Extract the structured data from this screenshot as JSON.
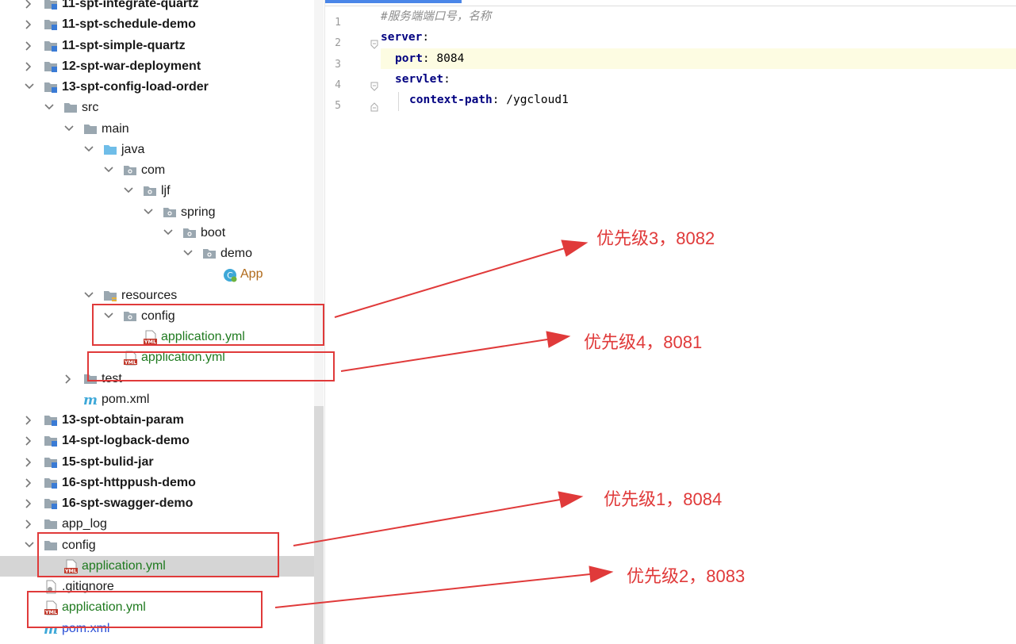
{
  "tree": {
    "rows": [
      {
        "label": "11-spt-integrate-quartz",
        "bold": true,
        "indent": 0,
        "chevron": "right",
        "icon": "module-folder-icon",
        "color": "normal"
      },
      {
        "label": "11-spt-schedule-demo",
        "bold": true,
        "indent": 0,
        "chevron": "right",
        "icon": "module-folder-icon",
        "color": "normal"
      },
      {
        "label": "11-spt-simple-quartz",
        "bold": true,
        "indent": 0,
        "chevron": "right",
        "icon": "module-folder-icon",
        "color": "normal"
      },
      {
        "label": "12-spt-war-deployment",
        "bold": true,
        "indent": 0,
        "chevron": "right",
        "icon": "module-folder-icon",
        "color": "normal"
      },
      {
        "label": "13-spt-config-load-order",
        "bold": true,
        "indent": 0,
        "chevron": "down",
        "icon": "module-folder-icon",
        "color": "normal"
      },
      {
        "label": "src",
        "bold": false,
        "indent": 1,
        "chevron": "down",
        "icon": "folder-icon",
        "color": "normal"
      },
      {
        "label": "main",
        "bold": false,
        "indent": 2,
        "chevron": "down",
        "icon": "folder-icon",
        "color": "normal"
      },
      {
        "label": "java",
        "bold": false,
        "indent": 3,
        "chevron": "down",
        "icon": "source-folder-icon",
        "color": "normal"
      },
      {
        "label": "com",
        "bold": false,
        "indent": 4,
        "chevron": "down",
        "icon": "package-icon",
        "color": "normal"
      },
      {
        "label": "ljf",
        "bold": false,
        "indent": 5,
        "chevron": "down",
        "icon": "package-icon",
        "color": "normal"
      },
      {
        "label": "spring",
        "bold": false,
        "indent": 6,
        "chevron": "down",
        "icon": "package-icon",
        "color": "normal"
      },
      {
        "label": "boot",
        "bold": false,
        "indent": 7,
        "chevron": "down",
        "icon": "package-icon",
        "color": "normal"
      },
      {
        "label": "demo",
        "bold": false,
        "indent": 8,
        "chevron": "down",
        "icon": "package-icon",
        "color": "normal"
      },
      {
        "label": "App",
        "bold": false,
        "indent": 9,
        "chevron": "none",
        "icon": "spring-class-icon",
        "color": "orange"
      },
      {
        "label": "resources",
        "bold": false,
        "indent": 3,
        "chevron": "down",
        "icon": "resources-folder-icon",
        "color": "normal"
      },
      {
        "label": "config",
        "bold": false,
        "indent": 4,
        "chevron": "down",
        "icon": "package-icon",
        "color": "normal"
      },
      {
        "label": "application.yml",
        "bold": false,
        "indent": 5,
        "chevron": "none",
        "icon": "yml-file-icon",
        "color": "green"
      },
      {
        "label": "application.yml",
        "bold": false,
        "indent": 4,
        "chevron": "none",
        "icon": "yml-file-icon",
        "color": "green"
      },
      {
        "label": "test",
        "bold": false,
        "indent": 2,
        "chevron": "right",
        "icon": "folder-icon",
        "color": "normal"
      },
      {
        "label": "pom.xml",
        "bold": false,
        "indent": 2,
        "chevron": "none",
        "icon": "maven-icon",
        "color": "normal"
      },
      {
        "label": "13-spt-obtain-param",
        "bold": true,
        "indent": 0,
        "chevron": "right",
        "icon": "module-folder-icon",
        "color": "normal"
      },
      {
        "label": "14-spt-logback-demo",
        "bold": true,
        "indent": 0,
        "chevron": "right",
        "icon": "module-folder-icon",
        "color": "normal"
      },
      {
        "label": "15-spt-bulid-jar",
        "bold": true,
        "indent": 0,
        "chevron": "right",
        "icon": "module-folder-icon",
        "color": "normal"
      },
      {
        "label": "16-spt-httppush-demo",
        "bold": true,
        "indent": 0,
        "chevron": "right",
        "icon": "module-folder-icon",
        "color": "normal"
      },
      {
        "label": "16-spt-swagger-demo",
        "bold": true,
        "indent": 0,
        "chevron": "right",
        "icon": "module-folder-icon",
        "color": "normal"
      },
      {
        "label": "app_log",
        "bold": false,
        "indent": 0,
        "chevron": "right",
        "icon": "folder-icon",
        "color": "normal"
      },
      {
        "label": "config",
        "bold": false,
        "indent": 0,
        "chevron": "down",
        "icon": "folder-icon",
        "color": "normal"
      },
      {
        "label": "application.yml",
        "bold": false,
        "indent": 1,
        "chevron": "none",
        "icon": "yml-file-icon",
        "color": "green",
        "selected": true
      },
      {
        "label": ".gitignore",
        "bold": false,
        "indent": 0,
        "chevron": "none",
        "icon": "gitignore-icon",
        "color": "normal"
      },
      {
        "label": "application.yml",
        "bold": false,
        "indent": 0,
        "chevron": "none",
        "icon": "yml-file-icon",
        "color": "green"
      },
      {
        "label": "pom.xml",
        "bold": false,
        "indent": 0,
        "chevron": "none",
        "icon": "maven-icon",
        "color": "blue"
      }
    ]
  },
  "editor": {
    "lines": [
      {
        "num": "1",
        "text": "#服务端端口号，名称",
        "kind": "comment",
        "indent": 0
      },
      {
        "num": "2",
        "key": "server",
        "after": ":",
        "kind": "key",
        "indent": 0
      },
      {
        "num": "3",
        "key": "port",
        "after": ": ",
        "value": "8084",
        "kind": "kv",
        "indent": 1,
        "highlight": true
      },
      {
        "num": "4",
        "key": "servlet",
        "after": ":",
        "kind": "key",
        "indent": 1
      },
      {
        "num": "5",
        "key": "context-path",
        "after": ": ",
        "value": "/ygcloud1",
        "kind": "kv",
        "indent": 2
      }
    ]
  },
  "annotations": [
    {
      "text": "优先级3，8082"
    },
    {
      "text": "优先级4，8081"
    },
    {
      "text": "优先级1，8084"
    },
    {
      "text": "优先级2，8083"
    }
  ],
  "colors": {
    "annotation": "#e03a3a",
    "accent": "#4a86e8",
    "green_file": "#1f7a1f"
  }
}
